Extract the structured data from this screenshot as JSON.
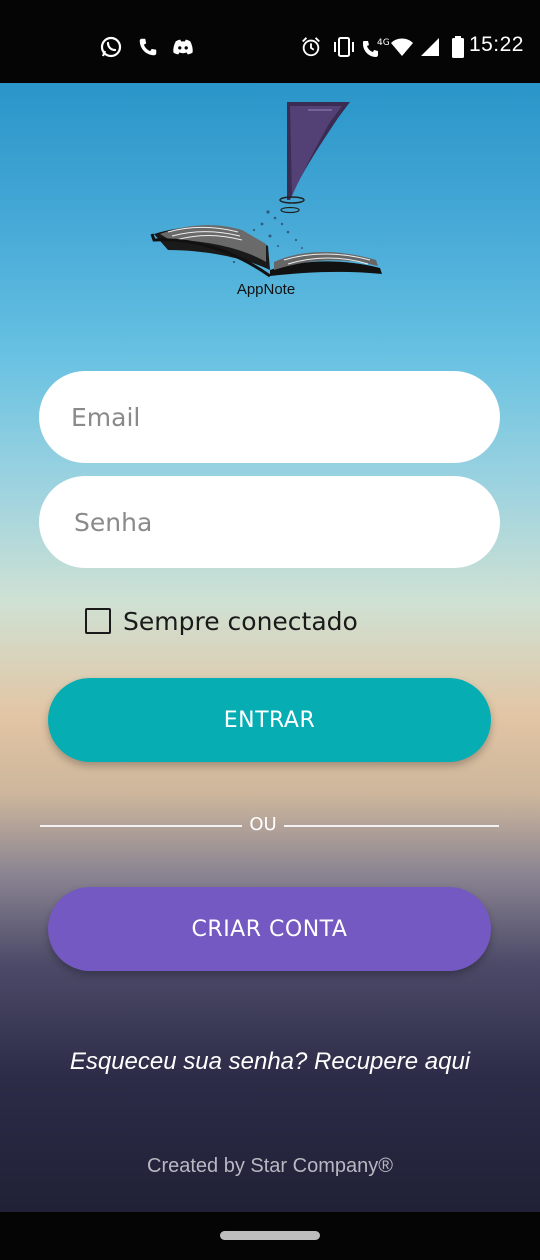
{
  "status_bar": {
    "time": "15:22",
    "network_label": "4G",
    "left_icons": [
      "whatsapp-icon",
      "phone-icon",
      "discord-icon"
    ],
    "right_icons": [
      "alarm-icon",
      "vibrate-icon",
      "volte-call-icon",
      "wifi-icon",
      "signal-icon",
      "battery-icon"
    ]
  },
  "logo": {
    "text": "AppNote"
  },
  "form": {
    "email_placeholder": "Email",
    "password_placeholder": "Senha",
    "remember_label": "Sempre conectado",
    "remember_checked": false
  },
  "buttons": {
    "login_label": "ENTRAR",
    "create_account_label": "CRIAR CONTA"
  },
  "divider": {
    "label": "OU"
  },
  "forgot_password": "Esqueceu sua senha? Recupere aqui",
  "footer": {
    "credit": "Created by Star Company®"
  },
  "colors": {
    "login_button": "#06aeb4",
    "create_button": "#7559c2",
    "field_background": "#ffffff"
  }
}
